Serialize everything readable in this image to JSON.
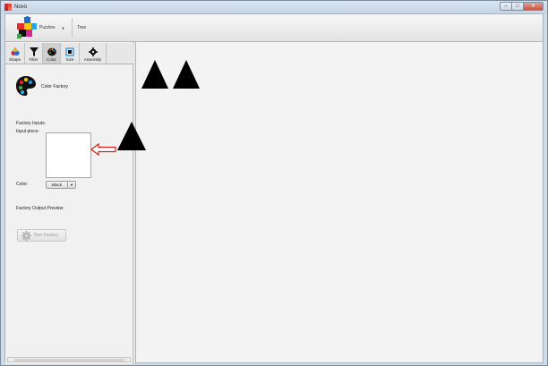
{
  "window": {
    "title": "Novo",
    "controls": [
      "minimize",
      "maximize",
      "close"
    ]
  },
  "toolbar": {
    "puzzles_label": "Puzzles",
    "tree_label": "Tree"
  },
  "tabs": [
    {
      "label": "Shape",
      "icon": "shape-icon"
    },
    {
      "label": "Filter",
      "icon": "filter-icon"
    },
    {
      "label": "Color",
      "icon": "palette-icon",
      "active": true
    },
    {
      "label": "Size",
      "icon": "resize-icon"
    },
    {
      "label": "Assembly",
      "icon": "gear-icon"
    }
  ],
  "factory": {
    "title": "Color Factory",
    "inputs_label": "Factory Inputs:",
    "input_piece_label": "Input piece:",
    "color_label": "Color:",
    "color_value": "Black",
    "output_preview_label": "Factory Output Preview:",
    "run_label": "Run Factory"
  },
  "canvas": {
    "shapes": [
      "triangle",
      "triangle",
      "triangle"
    ]
  },
  "colors": {
    "shape_fill": "#000000",
    "arrow": "#d31f1f",
    "selected_tab": "#cfcfcf"
  }
}
